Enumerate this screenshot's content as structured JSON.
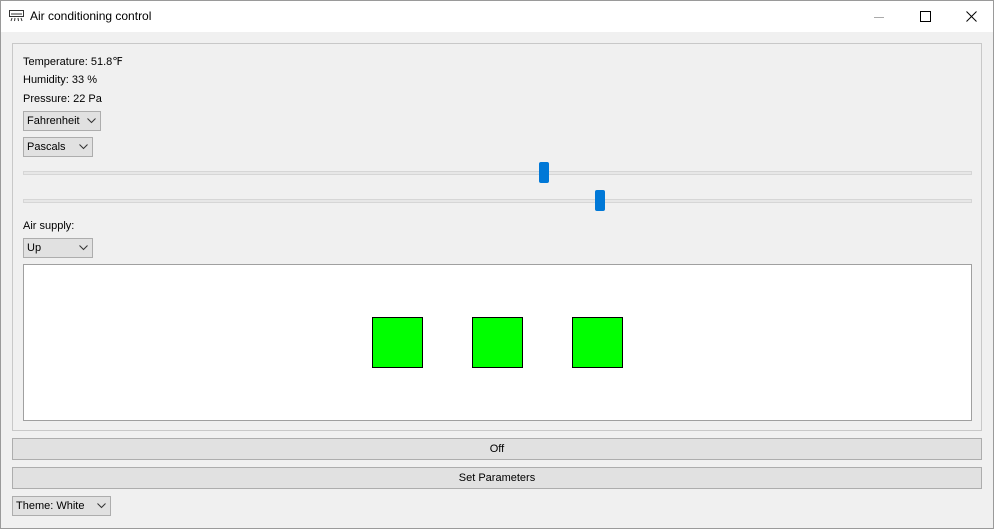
{
  "window": {
    "title": "Air conditioning control",
    "icons": {
      "app": "air-conditioner-icon",
      "minimize": "minimize-icon",
      "maximize": "maximize-icon",
      "close": "close-icon"
    }
  },
  "readouts": {
    "temperature": "Temperature: 51.8℉",
    "humidity": "Humidity: 33 %",
    "pressure": "Pressure: 22 Pa"
  },
  "selects": {
    "temperature_unit": "Fahrenheit",
    "pressure_unit": "Pascals",
    "air_supply": "Up",
    "theme": "Theme: White"
  },
  "sliders": {
    "slider_1_value": 0.549,
    "slider_2_value": 0.608
  },
  "air_supply_label": "Air supply:",
  "airflow_indicators": [
    {
      "color": "#00ff00"
    },
    {
      "color": "#00ff00"
    },
    {
      "color": "#00ff00"
    }
  ],
  "buttons": {
    "power": "Off",
    "set_parameters": "Set Parameters"
  },
  "colors": {
    "accent": "#0078d7",
    "indicator_on": "#00ff00"
  }
}
